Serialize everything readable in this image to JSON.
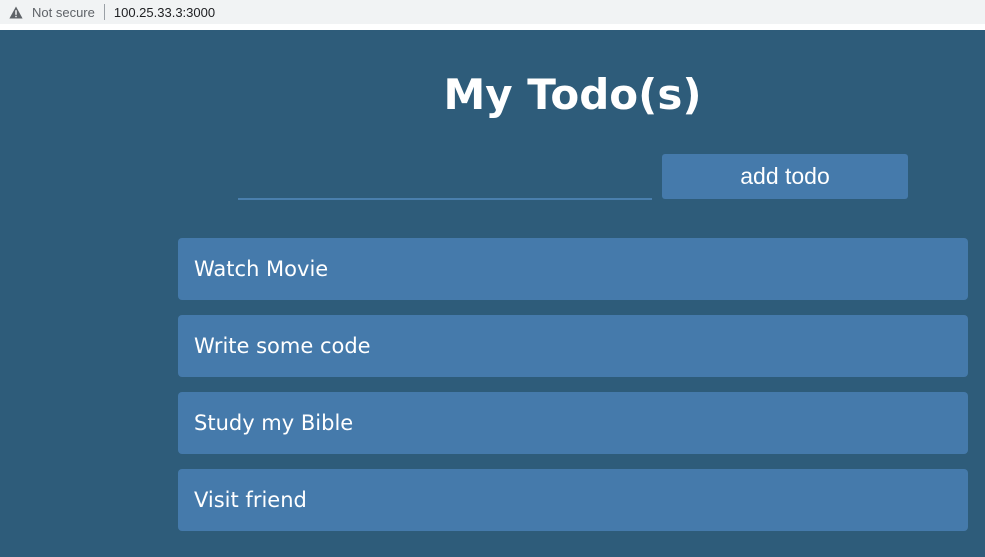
{
  "browser": {
    "security_label": "Not secure",
    "url": "100.25.33.3:3000"
  },
  "app": {
    "title": "My Todo(s)",
    "input": {
      "value": "",
      "placeholder": ""
    },
    "add_button_label": "add todo",
    "todos": [
      "Watch Movie",
      "Write some code",
      "Study my Bible",
      "Visit friend"
    ]
  },
  "colors": {
    "background": "#2e5c7a",
    "accent": "#457aab"
  },
  "icons": {
    "security": "warning-triangle-icon"
  }
}
